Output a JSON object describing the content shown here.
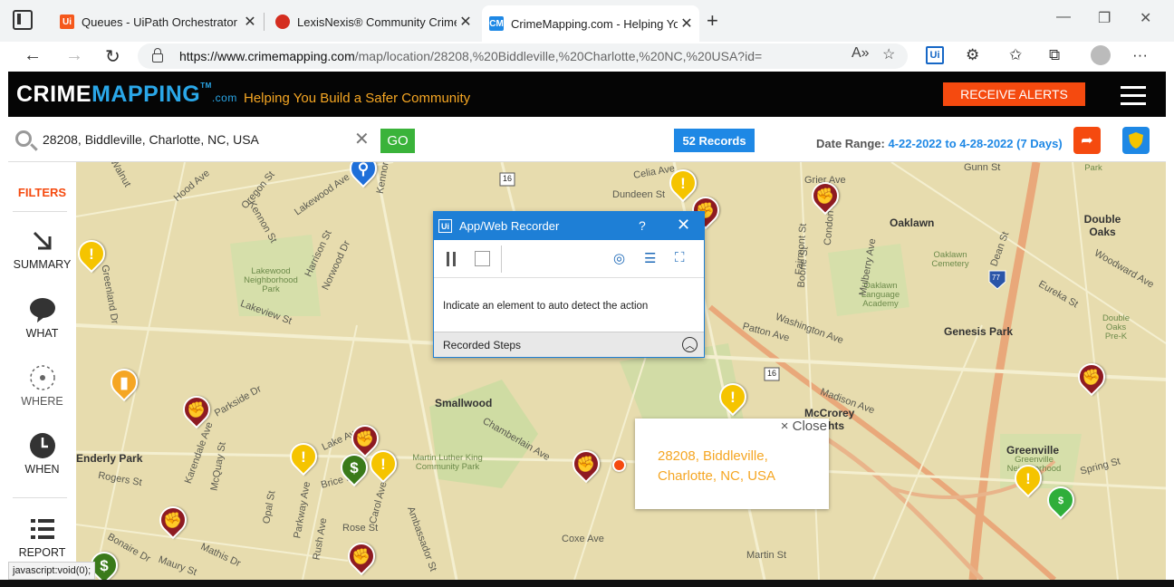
{
  "browser": {
    "tabs": [
      {
        "title": "Queues - UiPath Orchestrator",
        "favicon": "uipath-icon",
        "favicon_color": "#f5581c"
      },
      {
        "title": "LexisNexis® Community Crime M",
        "favicon": "lexisnexis-icon",
        "favicon_color": "#d42d1f"
      },
      {
        "title": "CrimeMapping.com - Helping Yo",
        "favicon": "crimemapping-icon",
        "favicon_color": "#1e88e5"
      }
    ],
    "url_host": "https://www.crimemapping.com",
    "url_path": "/map/location/28208,%20Biddleville,%20Charlotte,%20NC,%20USA?id="
  },
  "site": {
    "logo_crime": "CRIME",
    "logo_mapping": "MAPPING",
    "logo_tm": "TM",
    "logo_com": ".com",
    "tagline": "Helping You Build a Safer Community",
    "receive_alerts": "RECEIVE ALERTS",
    "colors": {
      "accent": "#f54a0f",
      "brand_blue": "#2aa7e8",
      "tagline": "#f5a623"
    }
  },
  "search": {
    "value": "28208, Biddleville, Charlotte, NC, USA",
    "go": "GO",
    "records": "52 Records",
    "date_label": "Date Range:",
    "date_value": "4-22-2022 to 4-28-2022 (7 Days)"
  },
  "sidebar": {
    "filters": "FILTERS",
    "items": [
      {
        "label": "SUMMARY",
        "icon": "arrow-down-right-icon"
      },
      {
        "label": "WHAT",
        "icon": "speech-bubble-icon"
      },
      {
        "label": "WHERE",
        "icon": "location-circle-icon"
      },
      {
        "label": "WHEN",
        "icon": "clock-icon"
      },
      {
        "label": "REPORT",
        "icon": "list-icon"
      }
    ]
  },
  "map": {
    "labels": [
      "Lakewood Ave",
      "Oregon St",
      "Kennon St",
      "Harrison St",
      "Norwood Dr",
      "Lakeview St",
      "Greenland Dr",
      "Parkside Dr",
      "Enderly Park",
      "Rogers St",
      "Karendale Ave",
      "McQuay St",
      "Opal St",
      "Bonaire Dr",
      "Mathis Dr",
      "Maury St",
      "Lake Ave",
      "Parkway Ave",
      "Brice St",
      "Rush Ave",
      "Rose St",
      "Carol Ave",
      "Ambassador St",
      "Smallwood",
      "Martin Luther King Community Park",
      "Chamberlain Ave",
      "Coxe Ave",
      "Martin St",
      "McCrorey Heights",
      "Washington Ave",
      "Madison Ave",
      "Patton Ave",
      "Oaklawn",
      "Oaklawn Cemetery",
      "Oaklawn Language Academy",
      "Genesis Park",
      "Double Oaks",
      "Greenville",
      "Greenville Neighborhood",
      "Spring St",
      "Eureka St",
      "Woodward Ave",
      "Dean St",
      "Fairmont St",
      "Condon St",
      "Boone St",
      "Mulberry Ave",
      "Celia Ave",
      "Dundeen St",
      "Grier Ave",
      "Gunn St",
      "Lakewood Neighborhood Park",
      "Double Oaks Pre-K",
      "Park",
      "Walnut",
      "Hood Ave",
      "Kennon"
    ],
    "callout_close": "Close",
    "callout_address_line1": "28208, Biddleville,",
    "callout_address_line2": "Charlotte, NC, USA",
    "route_shields": [
      "16",
      "16",
      "77"
    ]
  },
  "recorder": {
    "title": "App/Web Recorder",
    "help": "?",
    "message": "Indicate an element to auto detect the action",
    "recorded_steps": "Recorded Steps"
  },
  "status": {
    "tooltip": "javascript:void(0);"
  }
}
